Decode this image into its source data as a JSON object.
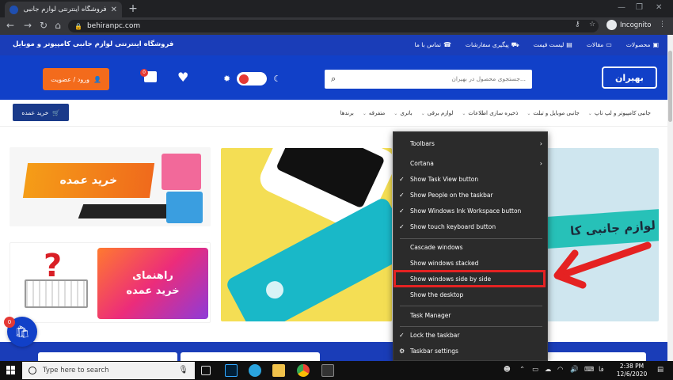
{
  "browser": {
    "tab_title": "فروشگاه اینترنتی لوازم جانبی کامپیوتر",
    "url": "behiranpc.com",
    "profile_label": "Incognito"
  },
  "site": {
    "shop_name": "فروشگاه اینترنتی لوازم جانبی کامپیوتر و موبایل",
    "top_links": [
      "محصولات",
      "مقالات",
      "لیست قیمت",
      "پیگیری سفارشات",
      "تماس با ما"
    ],
    "logo_text": "بهیران",
    "search_placeholder": "جستجوی محصول در بهیران...",
    "login_label": "ورود / عضویت",
    "cart_count": "0",
    "bulk_buy_label": "خرید عمده",
    "categories": [
      "جانبی کامپیوتر و لپ تاپ",
      "جانبی موبایل و تبلت",
      "ذخیره سازی اطلاعات",
      "لوازم برقی",
      "باتری",
      "متفرقه",
      "برندها"
    ],
    "banner1_text": "خرید عمده",
    "banner2_line1": "راهنمای",
    "banner2_line2": "خرید عمده",
    "banner4_text": "لوازم جانبی کا",
    "float_cart_count": "0"
  },
  "context_menu": {
    "items": [
      {
        "label": "Toolbars",
        "checked": false,
        "submenu": true
      },
      {
        "label": "Cortana",
        "checked": false,
        "submenu": true
      },
      {
        "label": "Show Task View button",
        "checked": true,
        "submenu": false
      },
      {
        "label": "Show People on the taskbar",
        "checked": true,
        "submenu": false
      },
      {
        "label": "Show Windows Ink Workspace button",
        "checked": true,
        "submenu": false
      },
      {
        "label": "Show touch keyboard button",
        "checked": true,
        "submenu": false
      },
      {
        "label": "Cascade windows",
        "checked": false,
        "submenu": false
      },
      {
        "label": "Show windows stacked",
        "checked": false,
        "submenu": false
      },
      {
        "label": "Show windows side by side",
        "checked": false,
        "submenu": false,
        "highlighted": true
      },
      {
        "label": "Show the desktop",
        "checked": false,
        "submenu": false
      },
      {
        "label": "Task Manager",
        "checked": false,
        "submenu": false
      },
      {
        "label": "Lock the taskbar",
        "checked": true,
        "submenu": false
      },
      {
        "label": "Taskbar settings",
        "checked": false,
        "submenu": false,
        "gear": true
      }
    ],
    "highlight_color": "#e52222"
  },
  "taskbar": {
    "search_placeholder": "Type here to search",
    "time": "2:38 PM",
    "date": "12/6/2020",
    "language": "فا"
  },
  "colors": {
    "brand_blue": "#1140c8",
    "accent_orange": "#f36b1c",
    "menu_bg": "#2b2b2b"
  }
}
